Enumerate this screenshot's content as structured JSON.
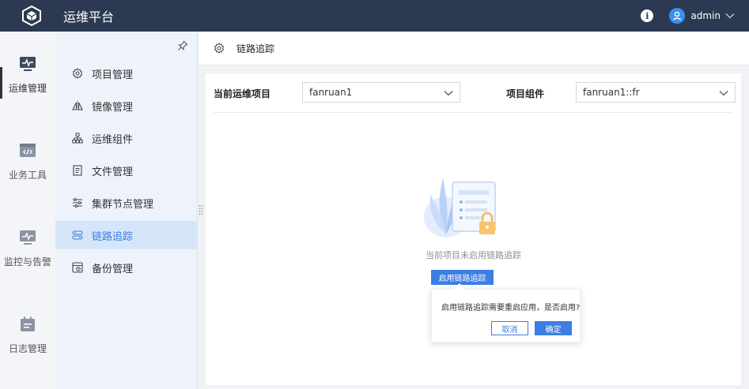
{
  "app": {
    "title": "运维平台"
  },
  "user": {
    "name": "admin"
  },
  "rail": {
    "items": [
      {
        "label": "运维管理",
        "icon": "monitor-pulse-icon",
        "active": true
      },
      {
        "label": "业务工具",
        "icon": "code-window-icon",
        "active": false
      },
      {
        "label": "监控与告警",
        "icon": "monitor-pulse-icon",
        "active": false
      },
      {
        "label": "日志管理",
        "icon": "calendar-log-icon",
        "active": false
      }
    ]
  },
  "submenu": {
    "items": [
      {
        "label": "项目管理",
        "icon": "gear-icon"
      },
      {
        "label": "镜像管理",
        "icon": "mirror-icon"
      },
      {
        "label": "运维组件",
        "icon": "org-chart-icon"
      },
      {
        "label": "文件管理",
        "icon": "document-icon"
      },
      {
        "label": "集群节点管理",
        "icon": "sliders-icon"
      },
      {
        "label": "链路追踪",
        "icon": "trace-icon",
        "active": true
      },
      {
        "label": "备份管理",
        "icon": "backup-icon"
      }
    ]
  },
  "header": {
    "title": "链路追踪"
  },
  "filters": {
    "project_label": "当前运维项目",
    "project_value": "fanruan1",
    "component_label": "项目组件",
    "component_value": "fanruan1::fr"
  },
  "empty_state": {
    "message": "当前项目未启用链路追踪",
    "button_label": "启用链路追踪"
  },
  "popconfirm": {
    "message": "启用链路追踪需要重启应用，是否启用?",
    "cancel_label": "取消",
    "ok_label": "确定"
  },
  "colors": {
    "topbar": "#2b3a52",
    "accent": "#3b7ee4",
    "submenu_bg": "#eef3fb",
    "active_item_bg": "#d6e6fa"
  }
}
